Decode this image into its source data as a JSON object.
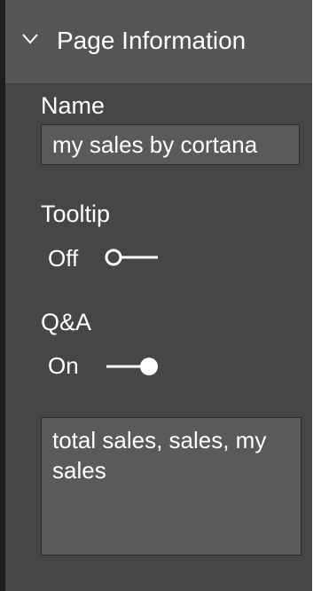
{
  "panel": {
    "section_title": "Page Information",
    "name": {
      "label": "Name",
      "value": "my sales by cortana"
    },
    "tooltip": {
      "label": "Tooltip",
      "state_text": "Off",
      "on": false
    },
    "qa": {
      "label": "Q&A",
      "state_text": "On",
      "on": true,
      "terms": "total sales, sales, my sales"
    }
  },
  "colors": {
    "panel_bg": "#464646",
    "header_bg": "#555555",
    "input_bg": "#5a5a5a",
    "text": "#ffffff"
  },
  "icons": {
    "header_chevron": "chevron-down-icon"
  }
}
